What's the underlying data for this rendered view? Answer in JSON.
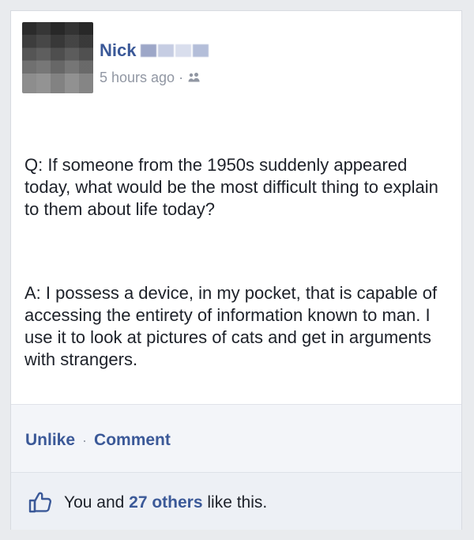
{
  "post": {
    "author_name": "Nick",
    "timestamp": "5 hours ago",
    "separator": "·",
    "audience_icon": "friends-icon",
    "paragraphs": [
      "Q: If someone from the 1950s suddenly appeared today, what would be the most difficult thing to explain to them about life today?",
      "A: I possess a device, in my pocket, that is capable of accessing the entirety of information known to man. I use it to look at pictures of cats and get in arguments with strangers."
    ]
  },
  "actions": {
    "unlike_label": "Unlike",
    "separator": "·",
    "comment_label": "Comment"
  },
  "likes": {
    "icon": "thumbs-up-icon",
    "prefix": "You and ",
    "count_label": "27 others",
    "suffix": " like this."
  },
  "colors": {
    "brand": "#3b5998",
    "text": "#1d2129",
    "muted": "#9197a3",
    "panel": "#f3f5f9"
  }
}
